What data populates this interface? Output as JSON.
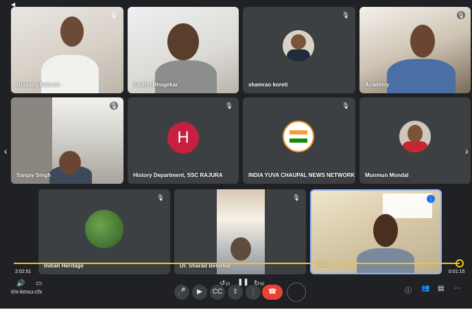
{
  "meeting": {
    "code": "i/m-kmxu-cfx",
    "elapsed": "2:02:51",
    "remaining": "0:01:15"
  },
  "participants": [
    {
      "name": "Bhujang Bobade",
      "muted": true,
      "video": true
    },
    {
      "name": "Sachin Bhogekar",
      "muted": false,
      "video": true
    },
    {
      "name": "shamrao koreti",
      "muted": true,
      "video": false
    },
    {
      "name": "Academy",
      "muted": true,
      "video": true
    },
    {
      "name": "Sanjay Singh",
      "muted": true,
      "video": true
    },
    {
      "name": "History Department, SSC RAJURA",
      "muted": true,
      "video": false,
      "initial": "H"
    },
    {
      "name": "INDIA YUVA CHAUPAL NEWS NETWORK",
      "muted": true,
      "video": false
    },
    {
      "name": "Munmun Mondal",
      "muted": false,
      "video": false
    },
    {
      "name": "Indian Heritage",
      "muted": true,
      "video": false
    },
    {
      "name": "Dr. Sharad Belorkar",
      "muted": true,
      "video": true
    },
    {
      "name": "You",
      "muted": false,
      "video": true,
      "speaking": true
    }
  ],
  "controls": {
    "skip_back": "10",
    "skip_forward": "30"
  },
  "colors": {
    "background": "#202124",
    "tile": "#3c4043",
    "accent_progress": "#f5c518",
    "end_call": "#ea4335",
    "speaking_border": "#8ab4f8"
  }
}
